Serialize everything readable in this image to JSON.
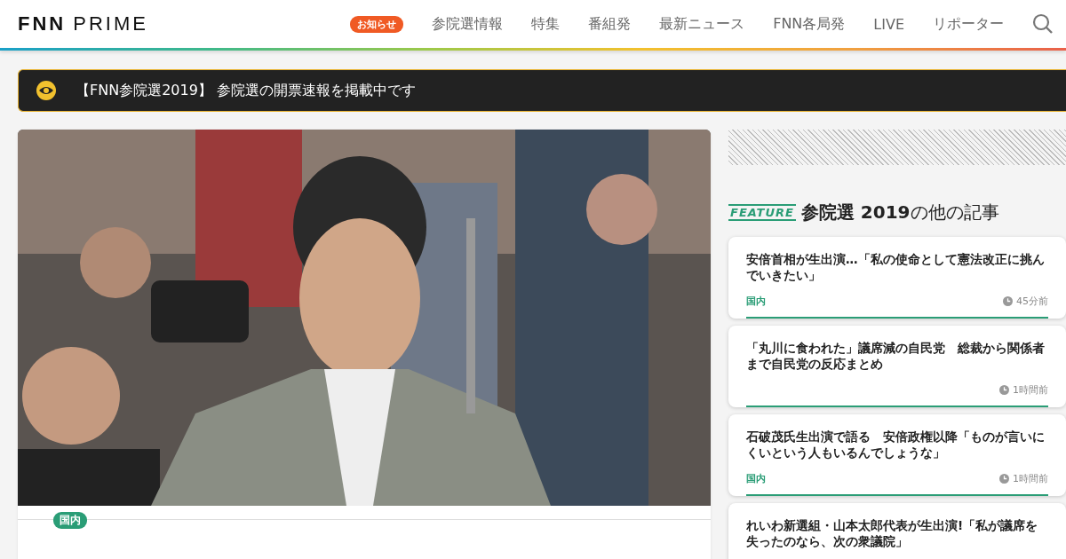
{
  "header": {
    "logo": {
      "part_1": "FNN",
      "part_2": "PRIME"
    },
    "notice_badge": "お知らせ",
    "nav": [
      "参院選情報",
      "特集",
      "番組発",
      "最新ニュース",
      "FNN各局発",
      "LIVE",
      "リポーター"
    ]
  },
  "banner": {
    "text": "【FNN参院選2019】 参院選の開票速報を掲載中です"
  },
  "hero": {
    "category": "国内"
  },
  "sidebar": {
    "feature_label": "FEATURE",
    "heading": "**参院選 2019**の他の記事",
    "articles": [
      {
        "title": "安倍首相が生出演…「私の使命として憲法改正に挑んでいきたい」",
        "category": "国内",
        "time": "45分前"
      },
      {
        "title": "「丸川に食われた」議席減の自民党　総裁から関係者まで自民党の反応まとめ",
        "time": "1時間前"
      },
      {
        "title": "石破茂氏生出演で語る　安倍政権以降「ものが言いにくいという人もいるんでしょうな」",
        "category": "国内",
        "time": "1時間前"
      },
      {
        "title": "れいわ新選組・山本太郎代表が生出演!「私が議席を失ったのなら、次の衆議院」"
      }
    ]
  }
}
